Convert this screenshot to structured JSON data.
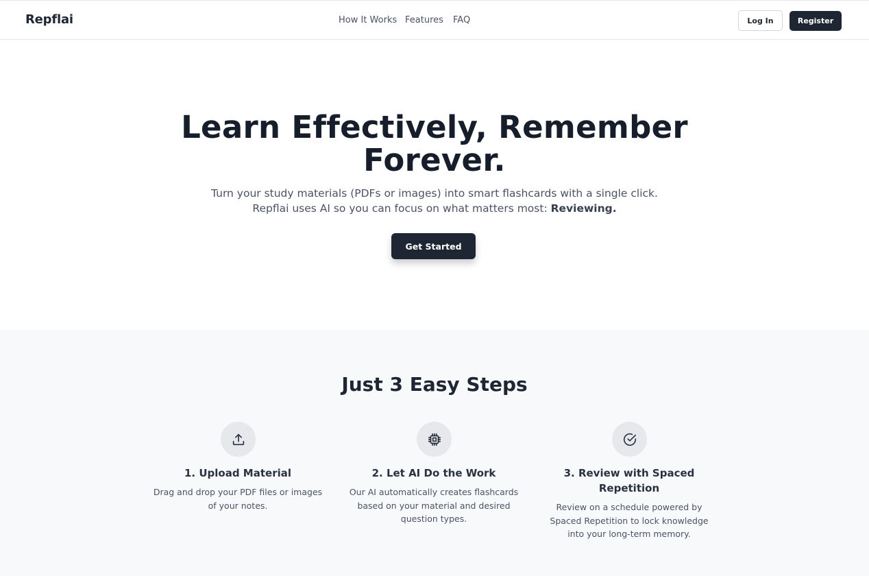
{
  "header": {
    "logo": "Repflai",
    "nav": [
      "How It Works",
      "Features",
      "FAQ"
    ],
    "login_label": "Log In",
    "register_label": "Register"
  },
  "hero": {
    "title": "Learn Effectively, Remember Forever.",
    "subtitle_line1": "Turn your study materials (PDFs or images) into smart flashcards with a single click.",
    "subtitle_line2": "Repflai uses AI so you can focus on what matters most: ",
    "subtitle_emphasis": "Reviewing.",
    "cta_label": "Get Started"
  },
  "steps": {
    "title": "Just 3 Easy Steps",
    "items": [
      {
        "icon": "upload-icon",
        "title": "1. Upload Material",
        "description": "Drag and drop your PDF files or images of your notes."
      },
      {
        "icon": "cpu-chip-icon",
        "title": "2. Let AI Do the Work",
        "description": "Our AI automatically creates flashcards based on your material and desired question types."
      },
      {
        "icon": "check-circle-icon",
        "title": "3. Review with Spaced Repetition",
        "description": "Review on a schedule powered by Spaced Repetition to lock knowledge into your long-term memory."
      }
    ]
  },
  "colors": {
    "primary": "#1e2533",
    "text_muted": "#4a5263",
    "section_bg": "#f8f9fb",
    "icon_bg": "#e6e8ec"
  }
}
